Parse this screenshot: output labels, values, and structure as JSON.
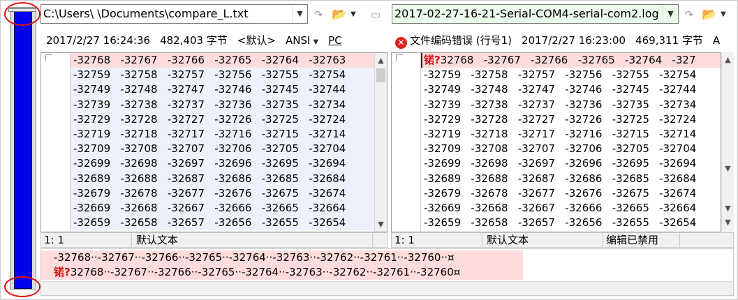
{
  "left": {
    "path": "C:\\Users\\        \\Documents\\compare_L.txt",
    "date": "2017/2/27 16:24:36",
    "size": "482,403 字节",
    "codepage": "<默认>",
    "encoding": "ANSI",
    "line_end": "PC",
    "rows": [
      "-32768   -32767   -32766   -32765   -32764   -32763",
      "-32759   -32758   -32757   -32756   -32755   -32754",
      "-32749   -32748   -32747   -32746   -32745   -32744",
      "-32739   -32738   -32737   -32736   -32735   -32734",
      "-32729   -32728   -32727   -32726   -32725   -32724",
      "-32719   -32718   -32717   -32716   -32715   -32714",
      "-32709   -32708   -32707   -32706   -32705   -32704",
      "-32699   -32698   -32697   -32696   -32695   -32694",
      "-32689   -32688   -32687   -32686   -32685   -32684",
      "-32679   -32678   -32677   -32676   -32675   -32674",
      "-32669   -32668   -32667   -32666   -32665   -32664",
      "-32659   -32658   -32657   -32656   -32655   -32654"
    ],
    "status_pos": "1: 1",
    "status_mode": "默认文本"
  },
  "right": {
    "path": "2017-02-27-16-21-Serial-COM4-serial-com2.log",
    "error": "文件编码错误 (行号1)",
    "date": "2017/2/27 16:23:00",
    "size": "469,311 字节",
    "extra": "A",
    "first_row_bad": "锘?",
    "first_row_rest": "32768   -32767   -32766   -32765   -32764   -327",
    "rows": [
      "-32759   -32758   -32757   -32756   -32755   -32754",
      "-32749   -32748   -32747   -32746   -32745   -32744",
      "-32739   -32738   -32737   -32736   -32735   -32734",
      "-32729   -32728   -32727   -32726   -32725   -32724",
      "-32719   -32718   -32717   -32716   -32715   -32714",
      "-32709   -32708   -32707   -32706   -32705   -32704",
      "-32699   -32698   -32697   -32696   -32695   -32694",
      "-32689   -32688   -32687   -32686   -32685   -32684",
      "-32679   -32678   -32677   -32676   -32675   -32674",
      "-32669   -32668   -32667   -32666   -32665   -32664",
      "-32659   -32658   -32657   -32656   -32655   -32654"
    ],
    "status_pos": "1: 1",
    "status_mode": "默认文本",
    "status_edit": "编辑已禁用"
  },
  "compare": {
    "line1": "-32768··-32767··-32766··-32765··-32764··-32763··-32762··-32761··-32760··¤",
    "line2_bad": "锘?",
    "line2_rest": "32768··-32767··-32766··-32765··-32764··-32763··-32762··-32761··-32760¤"
  },
  "icons": {
    "folder": "📂",
    "save": "▭",
    "reload": "↷",
    "error": "✕",
    "up": "▲",
    "down": "▼",
    "caret": "▼"
  },
  "colors": {
    "location_bar": "#0000ee",
    "diff_row": "#ffdcdc",
    "error_text": "#d01010"
  }
}
